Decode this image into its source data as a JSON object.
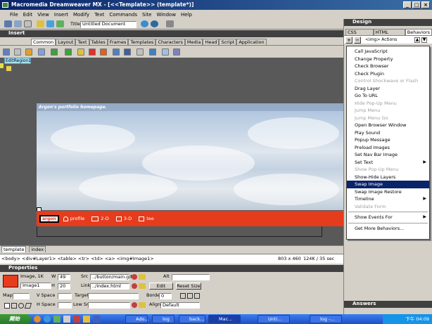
{
  "window": {
    "title": "Macromedia Dreamweaver MX - [<<Template>> (template*)]"
  },
  "menubar": [
    "File",
    "Edit",
    "View",
    "Insert",
    "Modify",
    "Text",
    "Commands",
    "Site",
    "Window",
    "Help"
  ],
  "toolbar": {
    "title_label": "Title:",
    "title_value": "Untitled Document"
  },
  "insert_panel": {
    "header": "Insert",
    "tabs": [
      "Common",
      "Layout",
      "Text",
      "Tables",
      "Frames",
      "Templates",
      "Characters",
      "Media",
      "Head",
      "Script",
      "Application"
    ]
  },
  "document": {
    "editable_region": "EditRegion1",
    "banner_text": "Argon's portfolio homepage.",
    "nav": {
      "logo": "argon",
      "items": [
        "profile",
        "2-D",
        "3-D",
        "tee"
      ]
    },
    "tabs": [
      "template",
      "index"
    ],
    "status_tags": "<body> <div#Layer1> <table> <tr> <td> <a> <img#Image1>",
    "status_info": "803 x 460",
    "status_size": "124K / 35 sec"
  },
  "properties": {
    "header": "Properties",
    "kind": "Image, 1K",
    "name": "Image1",
    "w_label": "W",
    "w_value": "49",
    "h_label": "H",
    "h_value": "20",
    "src_label": "Src",
    "src_value": "../button/main.gif",
    "link_label": "Link",
    "link_value": "../index.html",
    "alt_label": "Alt",
    "edit_button": "Edit",
    "reset_button": "Reset Size",
    "map_label": "Map",
    "vspace_label": "V Space",
    "hspace_label": "H Space",
    "target_label": "Target",
    "lowsrc_label": "Low Src",
    "border_label": "Border",
    "border_value": "0",
    "align_label": "Align",
    "align_value": "Default"
  },
  "right_panel": {
    "design_header": "Design",
    "tabs": [
      "CSS Styles",
      "HTML Styles",
      "Behaviors"
    ],
    "actions_label": "<img> Actions",
    "answers_header": "Answers"
  },
  "behaviors_menu": [
    {
      "label": "Call JavaScript",
      "state": "normal"
    },
    {
      "label": "Change Property",
      "state": "normal"
    },
    {
      "label": "Check Browser",
      "state": "normal"
    },
    {
      "label": "Check Plugin",
      "state": "normal"
    },
    {
      "label": "Control Shockwave or Flash",
      "state": "disabled"
    },
    {
      "label": "Drag Layer",
      "state": "normal"
    },
    {
      "label": "Go To URL",
      "state": "normal"
    },
    {
      "label": "Hide Pop-Up Menu",
      "state": "disabled"
    },
    {
      "label": "Jump Menu",
      "state": "disabled"
    },
    {
      "label": "Jump Menu Go",
      "state": "disabled"
    },
    {
      "label": "Open Browser Window",
      "state": "normal"
    },
    {
      "label": "Play Sound",
      "state": "normal"
    },
    {
      "label": "Popup Message",
      "state": "normal"
    },
    {
      "label": "Preload Images",
      "state": "normal"
    },
    {
      "label": "Set Nav Bar Image",
      "state": "normal"
    },
    {
      "label": "Set Text",
      "state": "submenu"
    },
    {
      "label": "Show Pop-Up Menu",
      "state": "disabled"
    },
    {
      "label": "Show-Hide Layers",
      "state": "normal"
    },
    {
      "label": "Swap Image",
      "state": "selected"
    },
    {
      "label": "Swap Image Restore",
      "state": "normal"
    },
    {
      "label": "Timeline",
      "state": "submenu"
    },
    {
      "label": "Validate Form",
      "state": "disabled"
    },
    {
      "label": "Show Events For",
      "state": "submenu"
    },
    {
      "label": "Get More Behaviors...",
      "state": "normal"
    }
  ],
  "taskbar": {
    "start": "開始",
    "tasks": [
      "Ado...",
      "log",
      "back...",
      "Mac...",
      "Unti...",
      "log -..."
    ],
    "clock": "下午 04:09"
  }
}
